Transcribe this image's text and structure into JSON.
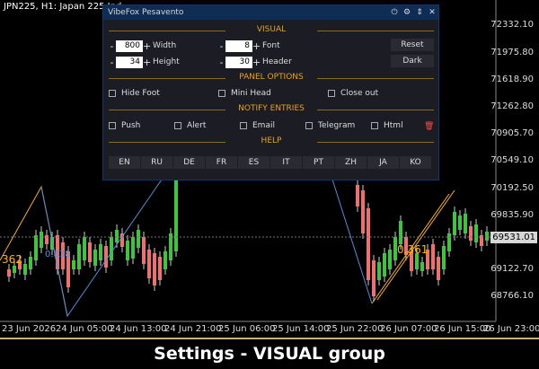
{
  "chart": {
    "symbol": "JPN225, H1:  Japan 225 Ind",
    "price_labels": [
      "72332.10",
      "71975.80",
      "71618.90",
      "71262.80",
      "70905.70",
      "70549.10",
      "70192.50",
      "69835.90",
      "69531.01",
      "69122.70",
      "68766.10"
    ],
    "current_price": "69531.01",
    "time_labels": [
      "23 Jun 2026",
      "24 Jun 05:00",
      "24 Jun 13:00",
      "24 Jun 21:00",
      "25 Jun 06:00",
      "25 Jun 14:00",
      "25 Jun 22:00",
      "26 Jun 07:00",
      "26 Jun 15:00",
      "26 Jun 23:00"
    ],
    "tag_left": "362",
    "tag_blue": "0.838",
    "tag_right": "0.361",
    "colors": {
      "bull": "#3ec53e",
      "bear": "#f07070",
      "zigzag_yellow": "#ffb300",
      "zigzag_blue": "#4a90e2"
    }
  },
  "panel": {
    "title": "VibeFox Pesavento",
    "title_icons": [
      "power-icon",
      "gear-icon",
      "arrows-icon",
      "close-icon"
    ],
    "visual_header": "VISUAL",
    "width_label": "Width",
    "width_value": "800",
    "height_label": "Height",
    "height_value": "34",
    "font_label": "Font",
    "font_value": "8",
    "header_label": "Header",
    "header_value": "30",
    "reset_label": "Reset",
    "dark_label": "Dark",
    "panel_options_header": "PANEL OPTIONS",
    "hide_foot_label": "Hide Foot",
    "mini_head_label": "Mini Head",
    "close_out_label": "Close out",
    "notify_header": "NOTIFY ENTRIES",
    "push_label": "Push",
    "alert_label": "Alert",
    "email_label": "Email",
    "telegram_label": "Telegram",
    "html_label": "Html",
    "help_header": "HELP",
    "languages": [
      "EN",
      "RU",
      "DE",
      "FR",
      "ES",
      "IT",
      "PT",
      "ZH",
      "JA",
      "KO"
    ],
    "minus": "-",
    "plus": "+"
  },
  "caption": "Settings - VISUAL group"
}
